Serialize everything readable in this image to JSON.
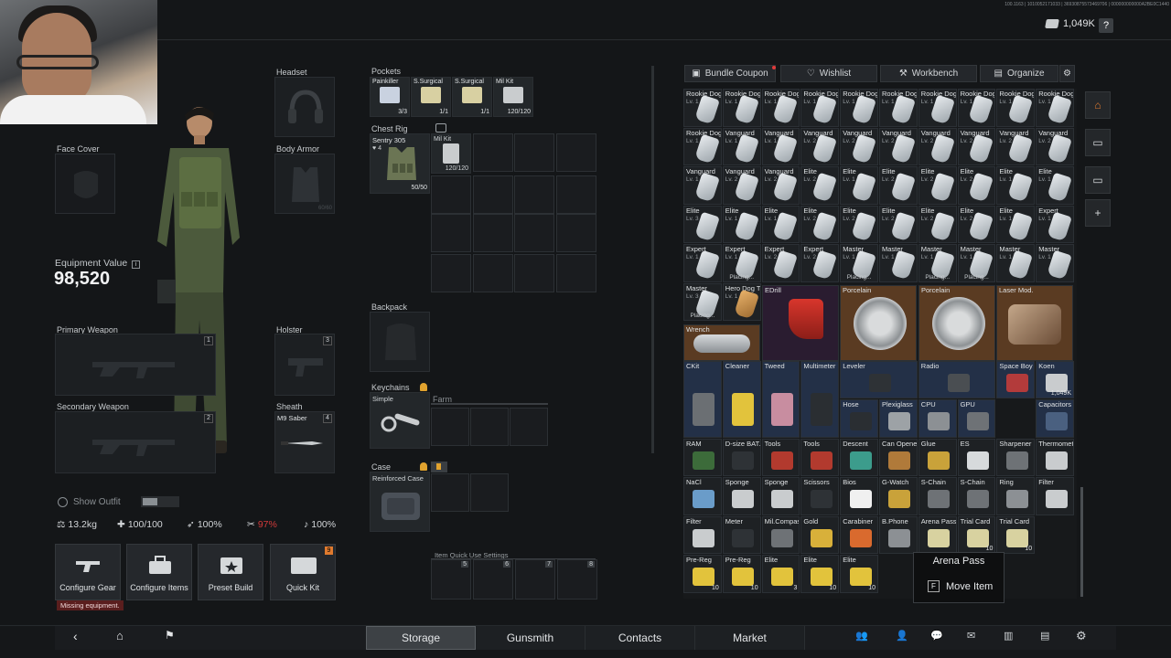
{
  "header": {
    "currency_value": "1,049K",
    "help_label": "?",
    "build_info": "100.1163 | 1010052171033 | 36930875573469706 | 000000000000A2BE0C1440"
  },
  "equipment": {
    "headset_label": "Headset",
    "face_cover_label": "Face Cover",
    "body_armor_label": "Body Armor",
    "equipment_value_label": "Equipment Value",
    "equipment_value": "98,520",
    "primary_weapon_label": "Primary Weapon",
    "primary_slot_num": "1",
    "secondary_weapon_label": "Secondary Weapon",
    "secondary_slot_num": "2",
    "holster_label": "Holster",
    "holster_slot_num": "3",
    "sheath_label": "Sheath",
    "sheath_item": "M9 Saber",
    "sheath_slot_num": "4",
    "armor_durability": "60/60",
    "show_outfit_label": "Show Outfit",
    "stats": {
      "weight": "13.2kg",
      "hp": "100/100",
      "stamina": "100%",
      "hunger": "97%",
      "hydration": "100%"
    },
    "missing_equipment": "Missing equipment."
  },
  "actions": [
    {
      "label": "Configure Gear"
    },
    {
      "label": "Configure Items"
    },
    {
      "label": "Preset Build"
    },
    {
      "label": "Quick Kit",
      "badge": "9"
    }
  ],
  "loadout": {
    "pockets_label": "Pockets",
    "pockets": [
      {
        "name": "Painkiller",
        "qty": "3/3"
      },
      {
        "name": "S.Surgical",
        "qty": "1/1"
      },
      {
        "name": "S.Surgical",
        "qty": "1/1"
      },
      {
        "name": "Mil Kit",
        "qty": "120/120"
      }
    ],
    "chest_rig_label": "Chest Rig",
    "chest_rig_item": "Sentry 305",
    "chest_rig_level": "4",
    "chest_rig_durability": "50/50",
    "chest_rig_mil_kit": "Mil Kit",
    "chest_rig_mil_kit_qty": "120/120",
    "backpack_label": "Backpack",
    "keychains_label": "Keychains",
    "keychain_item": "Simple",
    "keychain_slot": "Farm",
    "case_label": "Case",
    "case_item": "Reinforced Case",
    "quick_use_label": "Item Quick Use Settings",
    "quick_use_slots": [
      "5",
      "6",
      "7",
      "8"
    ]
  },
  "storage_toolbar": {
    "bundle_coupon": "Bundle Coupon",
    "wishlist": "Wishlist",
    "workbench": "Workbench",
    "organize": "Organize"
  },
  "storage_tags": [
    {
      "n": "Rookie Dog Tag",
      "lv": "Lv. 1"
    },
    {
      "n": "Rookie Dog Tag",
      "lv": "Lv. 1"
    },
    {
      "n": "Rookie Dog Tag",
      "lv": "Lv. 1"
    },
    {
      "n": "Rookie Dog Tag",
      "lv": "Lv. 1"
    },
    {
      "n": "Rookie Dog Tag",
      "lv": "Lv. 1"
    },
    {
      "n": "Rookie Dog Tag",
      "lv": "Lv. 1"
    },
    {
      "n": "Rookie Dog Tag",
      "lv": "Lv. 1"
    },
    {
      "n": "Rookie Dog Tag",
      "lv": "Lv. 1"
    },
    {
      "n": "Rookie Dog Tag",
      "lv": "Lv. 1"
    },
    {
      "n": "Rookie Dog Tag",
      "lv": "Lv. 1"
    },
    {
      "n": "Rookie Dog Tag",
      "lv": "Lv. 1"
    },
    {
      "n": "Vanguard",
      "lv": "Lv. 1"
    },
    {
      "n": "Vanguard",
      "lv": "Lv. 1"
    },
    {
      "n": "Vanguard",
      "lv": "Lv. 2"
    },
    {
      "n": "Vanguard",
      "lv": "Lv. 2"
    },
    {
      "n": "Vanguard",
      "lv": "Lv. 2"
    },
    {
      "n": "Vanguard",
      "lv": "Lv. 2"
    },
    {
      "n": "Vanguard",
      "lv": "Lv. 2"
    },
    {
      "n": "Vanguard",
      "lv": "Lv. 2"
    },
    {
      "n": "Vanguard",
      "lv": "Lv. 2"
    },
    {
      "n": "Vanguard",
      "lv": "Lv. 1"
    },
    {
      "n": "Vanguard",
      "lv": "Lv. 2"
    },
    {
      "n": "Vanguard",
      "lv": "Lv. 2"
    },
    {
      "n": "Elite",
      "lv": "Lv. 2"
    },
    {
      "n": "Elite",
      "lv": "Lv. 1"
    },
    {
      "n": "Elite",
      "lv": "Lv. 2"
    },
    {
      "n": "Elite",
      "lv": "Lv. 2"
    },
    {
      "n": "Elite",
      "lv": "Lv. 2"
    },
    {
      "n": "Elite",
      "lv": "Lv. 1"
    },
    {
      "n": "Elite",
      "lv": "Lv. 1"
    },
    {
      "n": "Elite",
      "lv": "Lv. 3"
    },
    {
      "n": "Elite",
      "lv": "Lv. 1"
    },
    {
      "n": "Elite",
      "lv": "Lv. 1"
    },
    {
      "n": "Elite",
      "lv": "Lv. 2"
    },
    {
      "n": "Elite",
      "lv": "Lv. 2"
    },
    {
      "n": "Elite",
      "lv": "Lv. 2"
    },
    {
      "n": "Elite",
      "lv": "Lv. 2"
    },
    {
      "n": "Elite",
      "lv": "Lv. 2"
    },
    {
      "n": "Elite",
      "lv": "Lv. 1"
    },
    {
      "n": "Expert",
      "lv": "Lv. 1"
    },
    {
      "n": "Expert",
      "lv": "Lv. 1"
    },
    {
      "n": "Expert",
      "lv": "Lv. 1",
      "s": "Placing..."
    },
    {
      "n": "Expert",
      "lv": "Lv. 2"
    },
    {
      "n": "Expert",
      "lv": "Lv. 2"
    },
    {
      "n": "Master",
      "lv": "Lv. 1",
      "s": "Placing..."
    },
    {
      "n": "Master",
      "lv": "Lv. 1"
    },
    {
      "n": "Master",
      "lv": "Lv. 1",
      "s": "Placing..."
    },
    {
      "n": "Master",
      "lv": "Lv. 1",
      "s": "Placing..."
    },
    {
      "n": "Master",
      "lv": "Lv. 1"
    },
    {
      "n": "Master",
      "lv": "Lv. 1"
    },
    {
      "n": "Master",
      "lv": "Lv. 3",
      "s": "Placing..."
    },
    {
      "n": "Hero Dog Tag",
      "lv": "Lv. 1"
    }
  ],
  "storage_big": [
    {
      "n": "EDrill"
    },
    {
      "n": "Porcelain"
    },
    {
      "n": "Porcelain"
    },
    {
      "n": "Laser Mod."
    },
    {
      "n": "Wrench"
    }
  ],
  "storage_items": [
    {
      "n": "CKit"
    },
    {
      "n": "Cleaner"
    },
    {
      "n": "Tweed"
    },
    {
      "n": "Multimeter"
    },
    {
      "n": "Leveler"
    },
    {
      "n": "Radio"
    },
    {
      "n": "Space Boy"
    },
    {
      "n": "Koen",
      "q": "1,049K"
    },
    {
      "n": "Hose"
    },
    {
      "n": "Plexiglass"
    },
    {
      "n": "CPU"
    },
    {
      "n": "GPU"
    },
    {
      "n": "Capacitors"
    },
    {
      "n": "RAM"
    },
    {
      "n": "D-size BAT."
    },
    {
      "n": "Tools"
    },
    {
      "n": "Tools"
    },
    {
      "n": "Descent"
    },
    {
      "n": "Can Opener"
    },
    {
      "n": "Glue"
    },
    {
      "n": "ES"
    },
    {
      "n": "Sharpener"
    },
    {
      "n": "Thermometer"
    },
    {
      "n": "NaCl"
    },
    {
      "n": "Sponge"
    },
    {
      "n": "Sponge"
    },
    {
      "n": "Scissors"
    },
    {
      "n": "Bios"
    },
    {
      "n": "G-Watch"
    },
    {
      "n": "S-Chain"
    },
    {
      "n": "S-Chain"
    },
    {
      "n": "Ring"
    },
    {
      "n": "Filter"
    },
    {
      "n": "Filter"
    },
    {
      "n": "Meter"
    },
    {
      "n": "Mil.Compass"
    },
    {
      "n": "Gold"
    },
    {
      "n": "Carabiner"
    },
    {
      "n": "B.Phone"
    },
    {
      "n": "Arena Pass"
    },
    {
      "n": "Trial Card",
      "q": "10"
    },
    {
      "n": "Trial Card",
      "q": "10"
    },
    {
      "n": "Pre-Reg",
      "q": "10"
    },
    {
      "n": "Pre-Reg",
      "q": "10"
    },
    {
      "n": "Elite",
      "q": "3"
    },
    {
      "n": "Elite",
      "q": "10"
    },
    {
      "n": "Elite",
      "q": "10"
    }
  ],
  "tooltip": {
    "title": "Arena Pass",
    "key": "F",
    "action": "Move Item"
  },
  "nav": {
    "tabs": [
      "Storage",
      "Gunsmith",
      "Contacts",
      "Market"
    ],
    "active": "Storage"
  },
  "colors": {
    "accent_orange": "#e07a2e",
    "hunger_red": "#d23a3a",
    "tag_blue": "#2a3c58",
    "tag_brown": "#5a3b22"
  }
}
